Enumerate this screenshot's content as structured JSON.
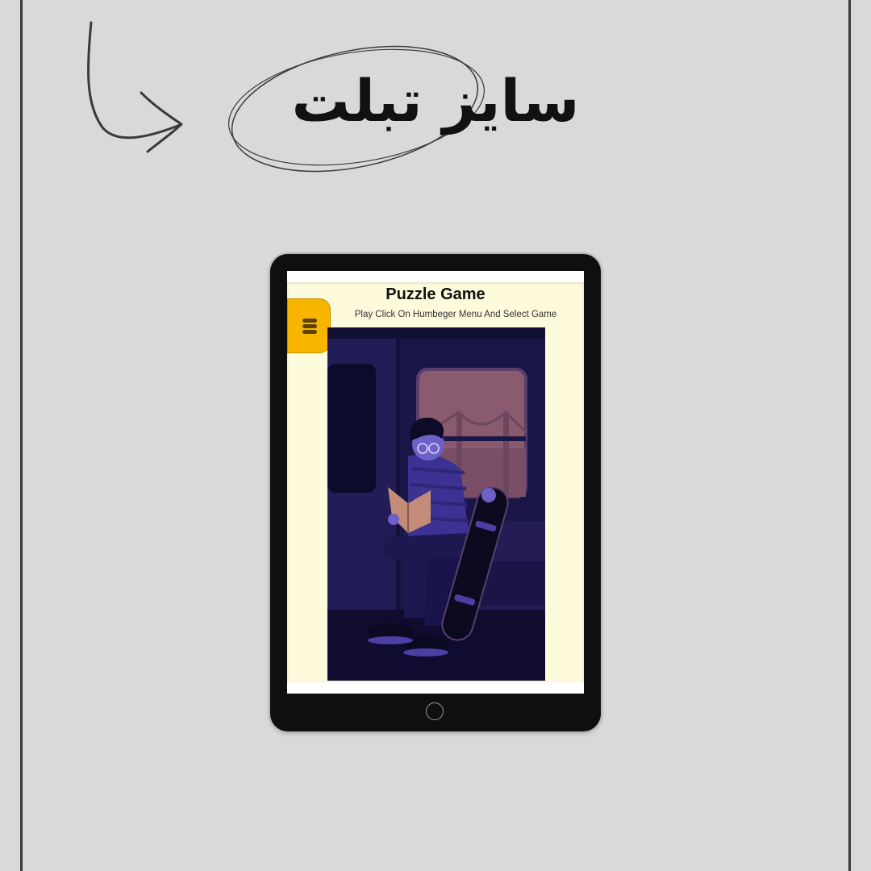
{
  "headline": "سايز تبلت",
  "tablet": {
    "app": {
      "title": "Puzzle Game",
      "instructions": "Play Click On Humbeger Menu And Select Game",
      "menu_button_icon": "hamburger-menu-icon",
      "puzzle_image_description": "man-reading-on-train-with-skateboard"
    },
    "home_button_icon": "home-button-icon"
  },
  "colors": {
    "background": "#d9d9d9",
    "page_background": "#fdfbdc",
    "menu_button": "#f7b500",
    "device_body": "#0f0f0f",
    "illustration_base": "#1a1545"
  }
}
